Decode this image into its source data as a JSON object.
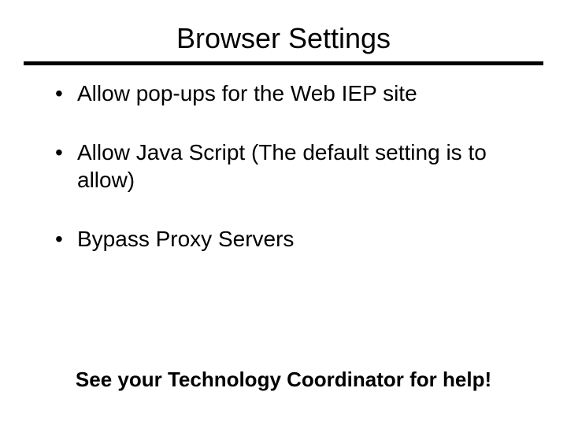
{
  "title": "Browser Settings",
  "bullets": [
    "Allow pop-ups for the Web IEP site",
    "Allow Java Script (The default setting is to allow)",
    "Bypass Proxy Servers"
  ],
  "footer": "See your Technology Coordinator for help!"
}
